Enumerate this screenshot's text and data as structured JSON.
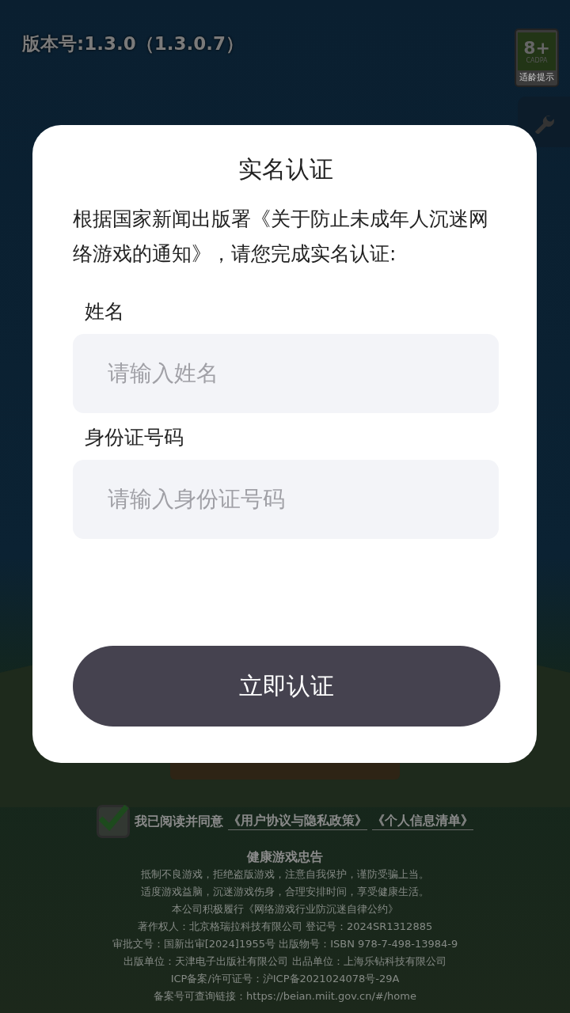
{
  "background": {
    "version": "版本号:1.3.0（1.3.0.7）",
    "age_badge": {
      "rating": "8+",
      "org": "CADPA",
      "caption": "适龄提示"
    },
    "agreement": {
      "checked": true,
      "text": "我已阅读并同意",
      "links": [
        "《用户协议与隐私政策》",
        "《个人信息清单》"
      ]
    },
    "notice": {
      "title": "健康游戏忠告",
      "lines": [
        "抵制不良游戏，拒绝盗版游戏，注意自我保护，谨防受骗上当。",
        "适度游戏益脑，沉迷游戏伤身，合理安排时间，享受健康生活。",
        "本公司积极履行《网络游戏行业防沉迷自律公约》",
        "著作权人：北京格瑞拉科技有限公司  登记号：2024SR1312885",
        "审批文号：国新出审[2024]1955号 出版物号：ISBN 978-7-498-13984-9",
        "出版单位：天津电子出版社有限公司 出品单位：上海乐钻科技有限公司",
        "ICP备案/许可证号：沪ICP备2021024078号-29A",
        "备案号可查询链接：https://beian.miit.gov.cn/#/home"
      ]
    }
  },
  "dialog": {
    "title": "实名认证",
    "description": "根据国家新闻出版署《关于防止未成年人沉迷网络游戏的通知》，请您完成实名认证:",
    "fields": [
      {
        "label": "姓名",
        "placeholder": "请输入姓名"
      },
      {
        "label": "身份证号码",
        "placeholder": "请输入身份证号码"
      }
    ],
    "button": "立即认证"
  }
}
